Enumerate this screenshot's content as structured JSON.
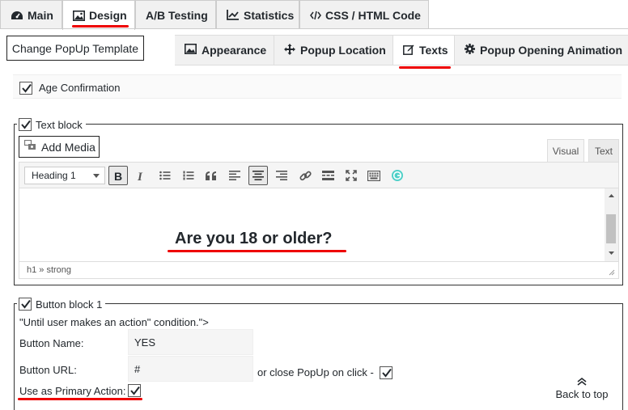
{
  "top_tabs": [
    {
      "label": "Main",
      "icon": "dashboard-icon"
    },
    {
      "label": "Design",
      "icon": "image-icon"
    },
    {
      "label": "A/B Testing",
      "icon": "ab-icon"
    },
    {
      "label": "Statistics",
      "icon": "chart-icon"
    },
    {
      "label": "CSS / HTML Code",
      "icon": "code-icon"
    }
  ],
  "template_button": "Change PopUp Template",
  "sub_tabs": [
    {
      "label": "Appearance",
      "icon": "image-icon"
    },
    {
      "label": "Popup Location",
      "icon": "move-icon"
    },
    {
      "label": "Texts",
      "icon": "edit-icon"
    },
    {
      "label": "Popup Opening Animation",
      "icon": "gear-icon"
    }
  ],
  "age_confirmation": {
    "label": "Age Confirmation",
    "checked": true
  },
  "text_block": {
    "legend": "Text block",
    "checked": true,
    "add_media": "Add Media",
    "editor_tabs": {
      "visual": "Visual",
      "text": "Text"
    },
    "format_select": "Heading 1",
    "content": "Are you 18 or older?",
    "path": "h1 » strong"
  },
  "button_block": {
    "legend": "Button block 1",
    "checked": true,
    "condition_text": "\"Until user makes an action\" condition.\">",
    "name_label": "Button Name:",
    "name_value": "YES",
    "url_label": "Button URL:",
    "url_value": "#",
    "close_label": "or close PopUp on click -",
    "close_checked": true,
    "primary_label": "Use as Primary Action:",
    "primary_checked": true
  },
  "back_to_top": "Back to top",
  "colors": {
    "underline": "#e00000",
    "tab_bg": "#f1f1f1",
    "border": "#cccccc"
  }
}
